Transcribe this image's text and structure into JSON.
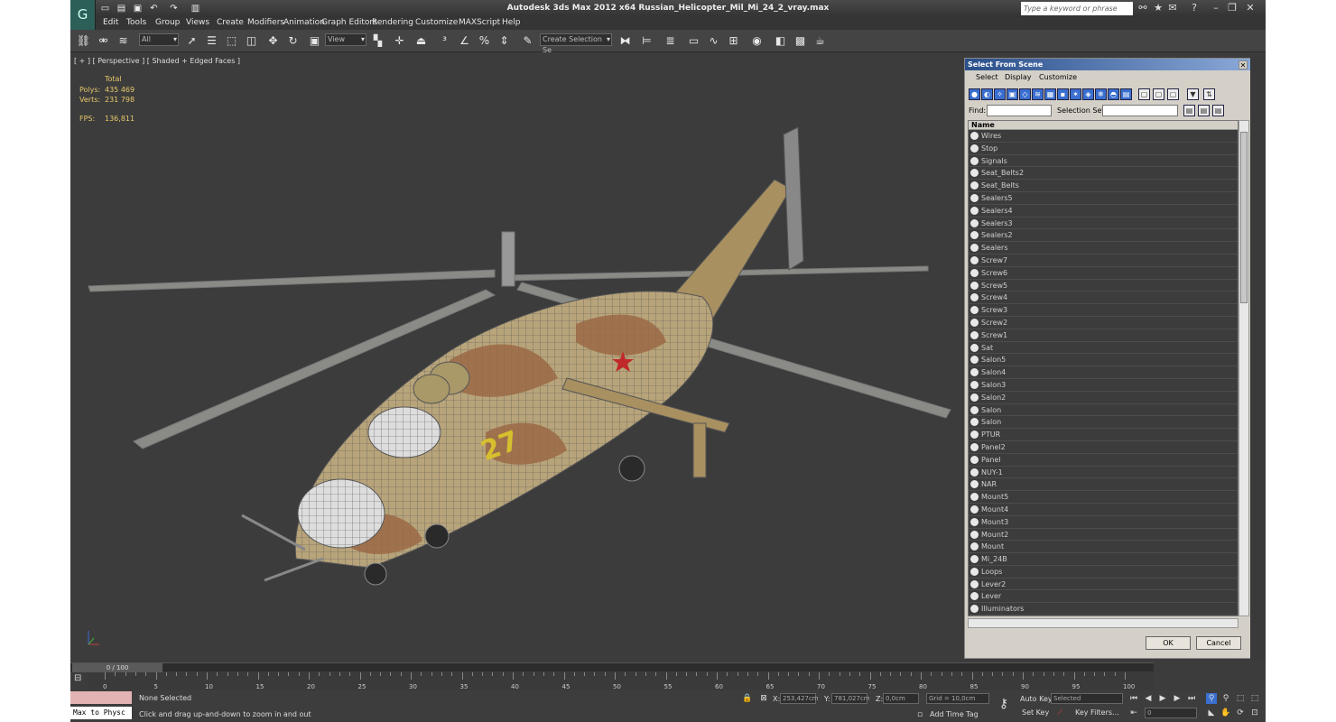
{
  "app": {
    "title": "Autodesk 3ds Max  2012 x64     Russian_Helicopter_Mil_Mi_24_2_vray.max",
    "search_placeholder": "Type a keyword or phrase",
    "logo_glyph": "G"
  },
  "menu": [
    "Edit",
    "Tools",
    "Group",
    "Views",
    "Create",
    "Modifiers",
    "Animation",
    "Graph Editors",
    "Rendering",
    "Customize",
    "MAXScript",
    "Help"
  ],
  "toolbar": {
    "filter_value": "All",
    "view_value": "View",
    "selection_set_placeholder": "Create Selection Se"
  },
  "viewport": {
    "label": "[ + ] [ Perspective ] [ Shaded + Edged Faces ]",
    "stats": {
      "total_label": "Total",
      "polys_label": "Polys:",
      "polys_value": "435 469",
      "verts_label": "Verts:",
      "verts_value": "231 798",
      "fps_label": "FPS:",
      "fps_value": "136,811"
    },
    "decal_number": "27"
  },
  "dialog": {
    "title": "Select From Scene",
    "menu": [
      "Select",
      "Display",
      "Customize"
    ],
    "find_label": "Find:",
    "selection_set_label": "Selection Set:",
    "column_name": "Name",
    "items": [
      "Wires",
      "Stop",
      "Signals",
      "Seat_Belts2",
      "Seat_Belts",
      "Sealers5",
      "Sealers4",
      "Sealers3",
      "Sealers2",
      "Sealers",
      "Screw7",
      "Screw6",
      "Screw5",
      "Screw4",
      "Screw3",
      "Screw2",
      "Screw1",
      "Sat",
      "Salon5",
      "Salon4",
      "Salon3",
      "Salon2",
      "Salon",
      "Salon",
      "PTUR",
      "Panel2",
      "Panel",
      "NUY-1",
      "NAR",
      "Mount5",
      "Mount4",
      "Mount3",
      "Mount2",
      "Mount",
      "Mi_24B",
      "Loops",
      "Lever2",
      "Lever",
      "Illuminators"
    ],
    "ok_label": "OK",
    "cancel_label": "Cancel"
  },
  "timeline": {
    "frame_label": "0 / 100",
    "ticks": [
      "0",
      "5",
      "10",
      "15",
      "20",
      "25",
      "30",
      "35",
      "40",
      "45",
      "50",
      "55",
      "60",
      "65",
      "70",
      "75",
      "80",
      "85",
      "90",
      "95",
      "100"
    ]
  },
  "status": {
    "maxscript_label": "Max to Physc",
    "selection_text": "None Selected",
    "prompt_text": "Click and drag up-and-down to zoom in and out",
    "x_label": "X:",
    "x_value": "253,427cm",
    "y_label": "Y:",
    "y_value": "781,027cm",
    "z_label": "Z:",
    "z_value": "0,0cm",
    "grid_text": "Grid = 10,0cm",
    "add_time_tag": "Add Time Tag",
    "auto_key": "Auto Key",
    "set_key": "Set Key",
    "key_mode_value": "Selected",
    "key_filters": "Key Filters...",
    "frame_value": "0"
  },
  "colors": {
    "dialog_title_start": "#2a4f8a",
    "stats_color": "#e8c86a",
    "viewport_bg": "#3c3c3c"
  }
}
